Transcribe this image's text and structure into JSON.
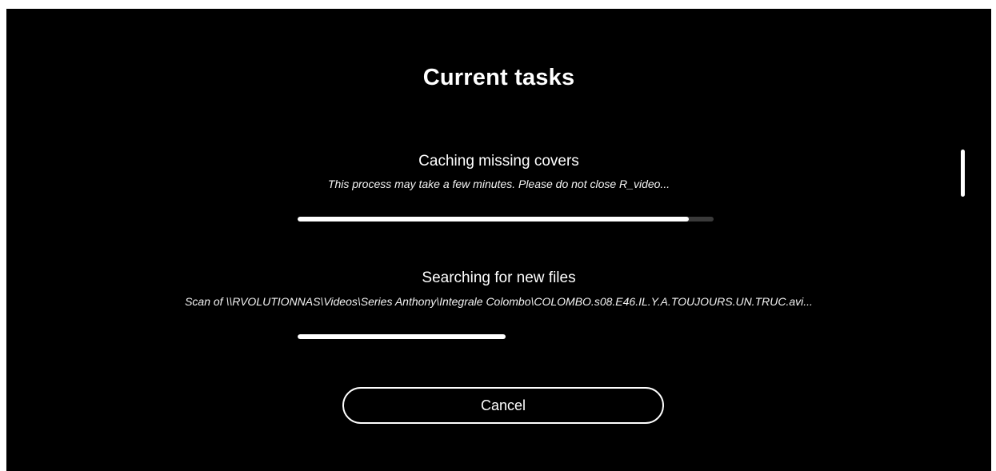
{
  "header": {
    "title": "Current tasks"
  },
  "tasks": [
    {
      "name": "Caching missing covers",
      "description": "This process may take a few minutes. Please do not close R_video...",
      "progress_fraction": 0.94
    },
    {
      "name": "Searching for new files",
      "description": "Scan of \\\\RVOLUTIONNAS\\Videos\\Series Anthony\\Integrale Colombo\\COLOMBO.s08.E46.IL.Y.A.TOUJOURS.UN.TRUC.avi...",
      "progress_fraction": 0.5
    }
  ],
  "actions": {
    "cancel_label": "Cancel"
  },
  "colors": {
    "background": "#000000",
    "text": "#ffffff",
    "progress_fill": "#ffffff",
    "progress_track": "#3a3a3a"
  }
}
